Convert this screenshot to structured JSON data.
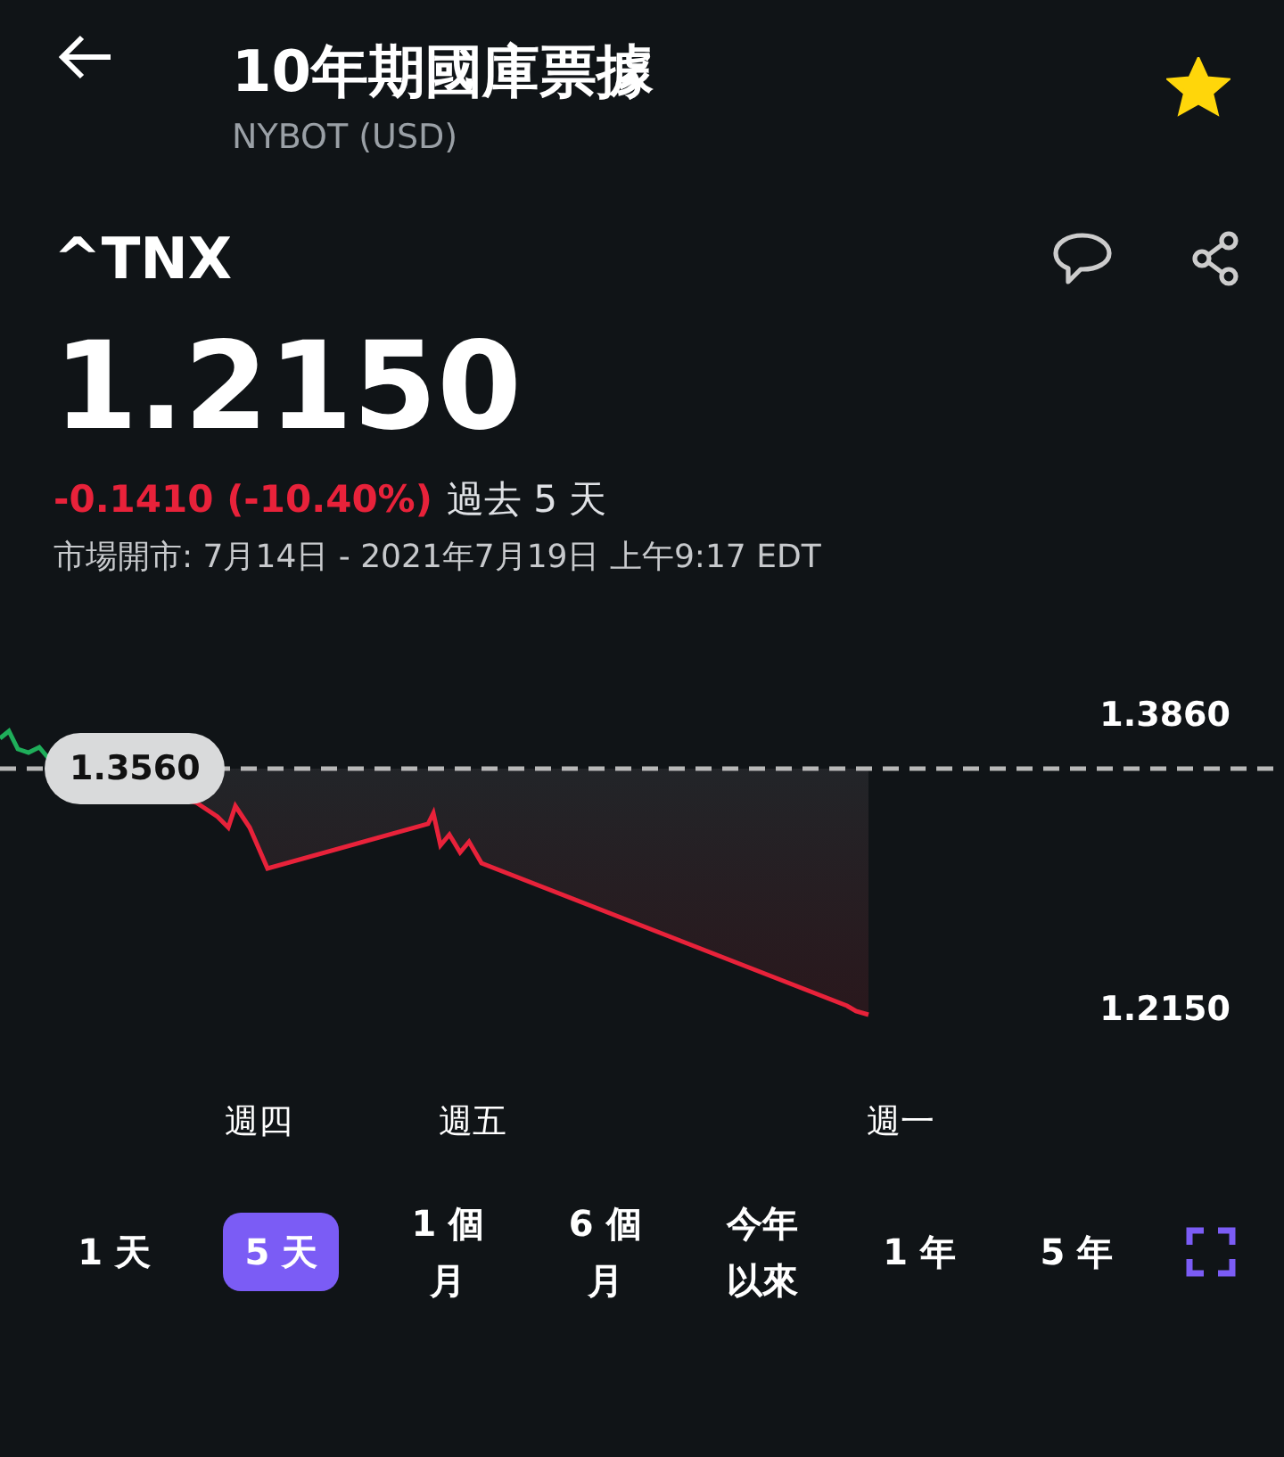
{
  "header": {
    "title": "10年期國庫票據",
    "subtitle": "NYBOT (USD)",
    "favorite": true
  },
  "quote": {
    "symbol": "^TNX",
    "price": "1.2150",
    "change": "-0.1410 (-10.40%)",
    "negative": true,
    "period": "過去 5 天",
    "market_time": "市場開市: 7月14日 - 2021年7月19日 上午9:17 EDT"
  },
  "chart": {
    "high_label": "1.3860",
    "low_label": "1.2150",
    "previous_close": "1.3560",
    "day_labels": [
      {
        "label": "週四",
        "kind": "thu"
      },
      {
        "label": "週五",
        "kind": "fri"
      },
      {
        "label": "週一",
        "kind": "mon"
      }
    ]
  },
  "ranges": [
    {
      "label": "1 天",
      "selected": false
    },
    {
      "label": "5 天",
      "selected": true
    },
    {
      "label": "1 個月",
      "selected": false
    },
    {
      "label": "6 個月",
      "selected": false
    },
    {
      "label": "今年以來",
      "selected": false
    },
    {
      "label": "1 年",
      "selected": false
    },
    {
      "label": "5 年",
      "selected": false
    }
  ]
}
